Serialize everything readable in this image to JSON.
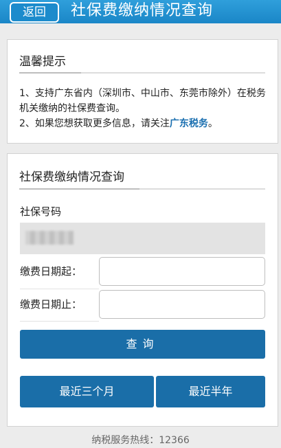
{
  "header": {
    "back_label": "返回",
    "title": "社保费缴纳情况查询"
  },
  "tips": {
    "heading": "温馨提示",
    "line1": "1、支持广东省内（深圳市、中山市、东莞市除外）在税务机关缴纳的社保费查询。",
    "line2_prefix": "2、如果您想获取更多信息，请关注",
    "line2_link": "广东税务",
    "line2_suffix": "。"
  },
  "query": {
    "heading": "社保费缴纳情况查询",
    "ss_number_label": "社保号码",
    "start_label": "缴费日期起：",
    "end_label": "缴费日期止：",
    "query_button": "查询",
    "recent_3m_button": "最近三个月",
    "recent_6m_button": "最近半年"
  },
  "footer": {
    "hotline": "纳税服务热线：12366"
  },
  "colors": {
    "header_bg": "#1a86c7",
    "button_bg": "#1a6ea8",
    "link": "#1a6fb0"
  }
}
